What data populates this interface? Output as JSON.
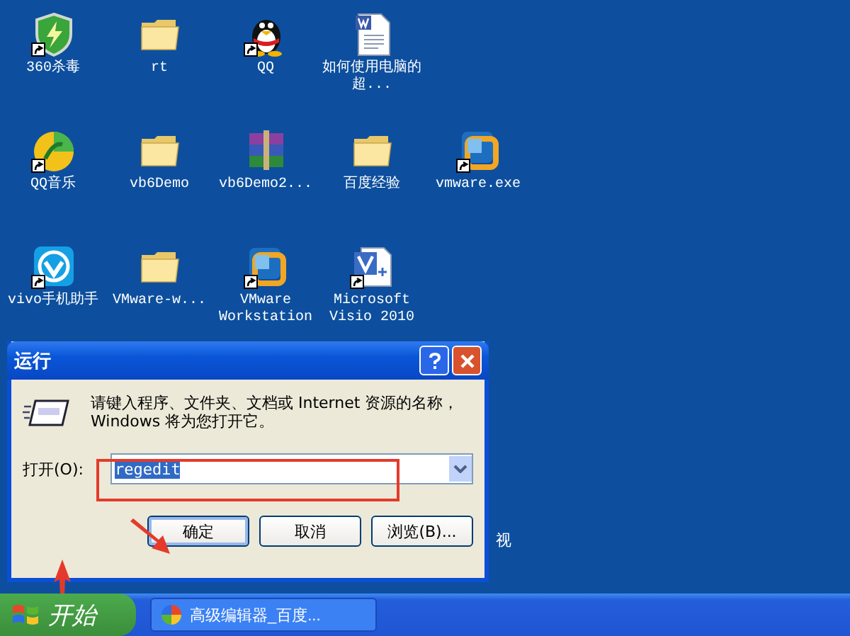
{
  "desktop": {
    "icon_rows": [
      [
        {
          "label": "360杀毒",
          "kind": "shield",
          "shortcut": true
        },
        {
          "label": "rt",
          "kind": "folder",
          "shortcut": false
        },
        {
          "label": "QQ",
          "kind": "penguin",
          "shortcut": true
        },
        {
          "label": "如何使用电脑的超...",
          "kind": "document",
          "shortcut": false
        }
      ],
      [
        {
          "label": "QQ音乐",
          "kind": "music",
          "shortcut": true
        },
        {
          "label": "vb6Demo",
          "kind": "folder",
          "shortcut": false
        },
        {
          "label": "vb6Demo2...",
          "kind": "archive",
          "shortcut": false
        },
        {
          "label": "百度经验",
          "kind": "folder",
          "shortcut": false
        },
        {
          "label": "vmware.exe",
          "kind": "vmware",
          "shortcut": true
        }
      ],
      [
        {
          "label": "vivo手机助手",
          "kind": "vivo",
          "shortcut": true
        },
        {
          "label": "VMware-w...",
          "kind": "folder",
          "shortcut": false
        },
        {
          "label": "VMware Workstation",
          "kind": "vmware",
          "shortcut": true
        },
        {
          "label": "Microsoft Visio 2010",
          "kind": "visio",
          "shortcut": true
        }
      ]
    ],
    "hidden_icon_label": "视"
  },
  "run_dialog": {
    "title": "运行",
    "prompt": "请键入程序、文件夹、文档或 Internet 资源的名称，Windows 将为您打开它。",
    "open_label": "打开(O):",
    "value": "regedit",
    "value_selected": true,
    "buttons": [
      {
        "label": "确定",
        "selected": true
      },
      {
        "label": "取消",
        "selected": false
      },
      {
        "label": "浏览(B)...",
        "selected": false
      }
    ]
  },
  "taskbar": {
    "start": "开始",
    "tasks": [
      {
        "label": "高级编辑器_百度...",
        "selected": false
      }
    ]
  }
}
